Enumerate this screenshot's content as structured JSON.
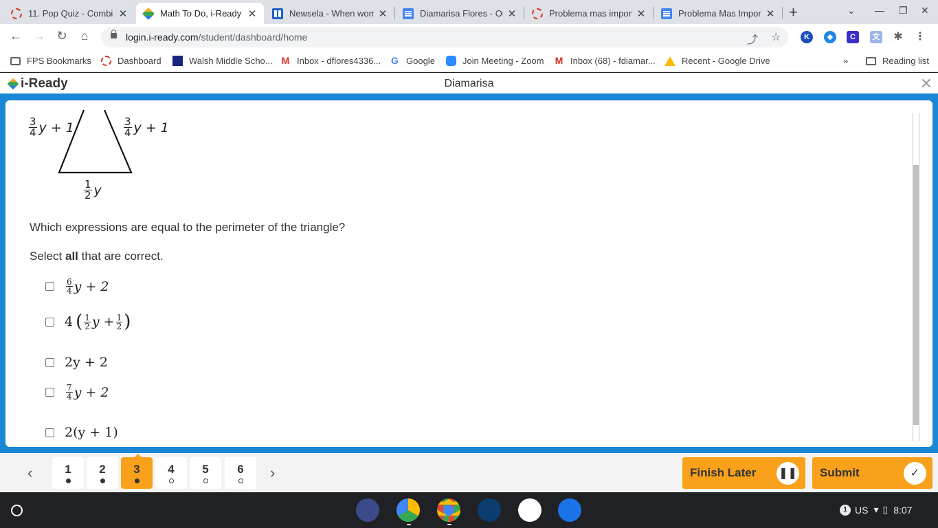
{
  "browser": {
    "tabs": [
      {
        "title": "11. Pop Quiz - Combi",
        "favicon": "loading-red-icon"
      },
      {
        "title": "Math To Do, i-Ready",
        "favicon": "iready-icon",
        "active": true
      },
      {
        "title": "Newsela - When wom",
        "favicon": "newsela-icon"
      },
      {
        "title": "Diamarisa Flores - On",
        "favicon": "google-docs-icon"
      },
      {
        "title": "Problema mas import",
        "favicon": "loading-red-icon"
      },
      {
        "title": "Problema Mas Impor",
        "favicon": "google-docs-icon"
      }
    ],
    "url_host": "login.i-ready.com",
    "url_path": "/student/dashboard/home",
    "bookmarks": [
      {
        "label": "FPS Bookmarks"
      },
      {
        "label": "Dashboard"
      },
      {
        "label": "Walsh Middle Scho..."
      },
      {
        "label": "Inbox - dflores4336..."
      },
      {
        "label": "Google"
      },
      {
        "label": "Join Meeting - Zoom"
      },
      {
        "label": "Inbox (68) - fdiamar..."
      },
      {
        "label": "Recent - Google Drive"
      }
    ],
    "reading_list": "Reading list",
    "bookmarks_more": "»"
  },
  "app": {
    "logo": "i-Ready",
    "student_name": "Diamarisa"
  },
  "problem": {
    "figure": {
      "left_side_frac": {
        "num": "3",
        "den": "4"
      },
      "left_side_rest": "y + 1",
      "right_side_frac": {
        "num": "3",
        "den": "4"
      },
      "right_side_rest": "y + 1",
      "base_frac": {
        "num": "1",
        "den": "2"
      },
      "base_var": "y"
    },
    "question": "Which expressions are equal to the perimeter of the triangle?",
    "instruction_pre": "Select ",
    "instruction_bold": "all",
    "instruction_post": " that are correct.",
    "choices": [
      {
        "frac_num": "6",
        "frac_den": "4",
        "text": "y + 2"
      },
      {
        "prefix": "4",
        "f1_num": "1",
        "f1_den": "2",
        "mid": "y +",
        "f2_num": "1",
        "f2_den": "2"
      },
      {
        "text": "2y + 2"
      },
      {
        "frac_num": "7",
        "frac_den": "4",
        "text": "y + 2"
      },
      {
        "text": "2(y + 1)"
      }
    ]
  },
  "pagination": {
    "pages": [
      {
        "num": "1",
        "status": "answered"
      },
      {
        "num": "2",
        "status": "answered"
      },
      {
        "num": "3",
        "status": "answered",
        "current": true
      },
      {
        "num": "4",
        "status": "unanswered"
      },
      {
        "num": "5",
        "status": "unanswered"
      },
      {
        "num": "6",
        "status": "unanswered"
      }
    ]
  },
  "actions": {
    "finish_later": "Finish Later",
    "submit": "Submit"
  },
  "shelf": {
    "locale": "US",
    "time": "8:07",
    "notification_count": "1"
  },
  "colors": {
    "iready_blue": "#1a86d6",
    "iready_orange": "#f9a11b"
  }
}
